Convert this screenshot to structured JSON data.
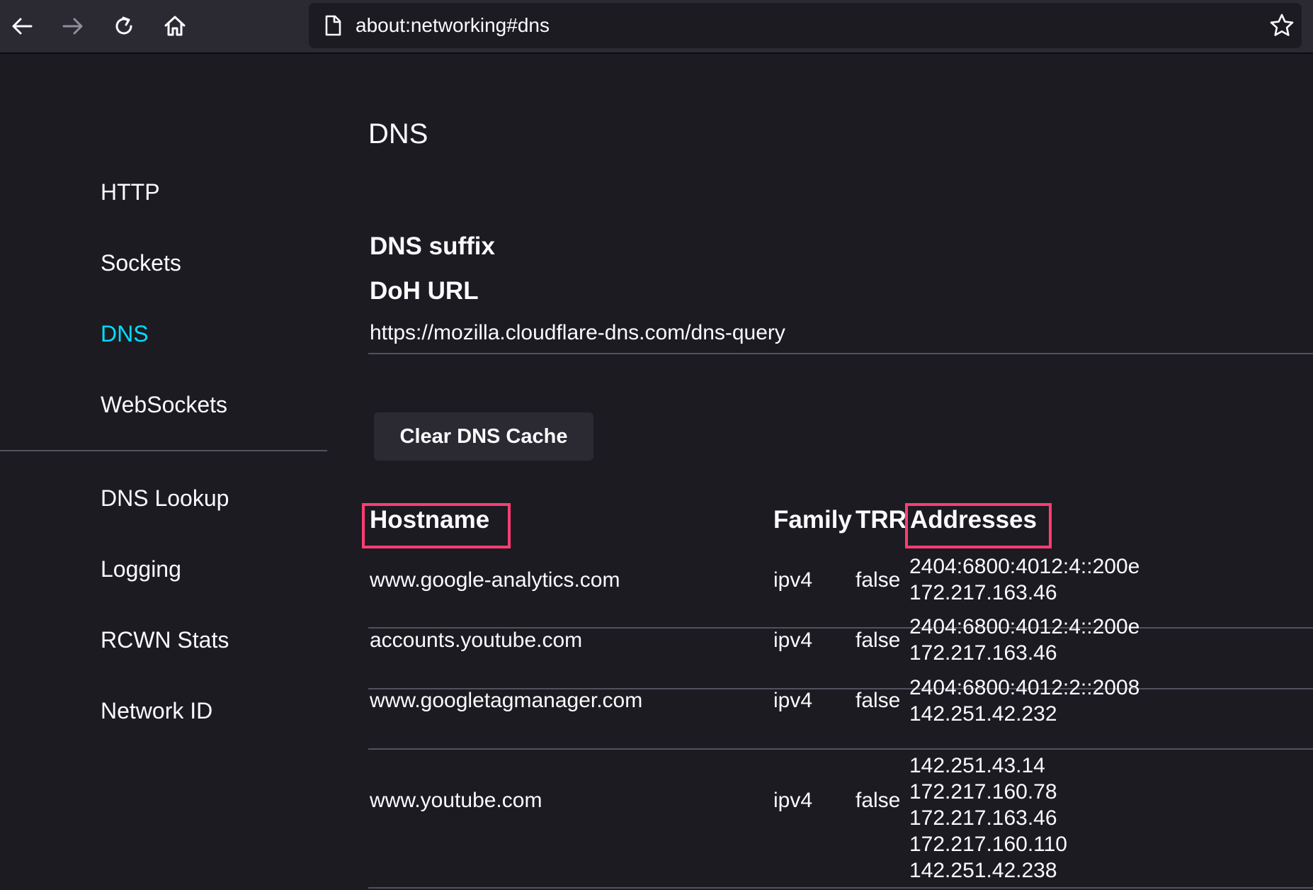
{
  "browser": {
    "url": "about:networking#dns"
  },
  "sidebar": {
    "items": [
      {
        "label": "HTTP"
      },
      {
        "label": "Sockets"
      },
      {
        "label": "DNS"
      },
      {
        "label": "WebSockets"
      },
      {
        "label": "DNS Lookup"
      },
      {
        "label": "Logging"
      },
      {
        "label": "RCWN Stats"
      },
      {
        "label": "Network ID"
      }
    ],
    "selected": "DNS"
  },
  "main": {
    "title": "DNS",
    "dns_suffix_heading": "DNS suffix",
    "doh_url_heading": "DoH URL",
    "doh_url_value": "https://mozilla.cloudflare-dns.com/dns-query",
    "clear_button": "Clear DNS Cache",
    "table": {
      "headers": {
        "hostname": "Hostname",
        "family": "Family",
        "trr": "TRR",
        "addresses": "Addresses"
      },
      "rows": [
        {
          "hostname": "www.google-analytics.com",
          "family": "ipv4",
          "trr": "false",
          "addresses": [
            "2404:6800:4012:4::200e",
            "172.217.163.46"
          ]
        },
        {
          "hostname": "accounts.youtube.com",
          "family": "ipv4",
          "trr": "false",
          "addresses": [
            "2404:6800:4012:4::200e",
            "172.217.163.46"
          ]
        },
        {
          "hostname": "www.googletagmanager.com",
          "family": "ipv4",
          "trr": "false",
          "addresses": [
            "2404:6800:4012:2::2008",
            "142.251.42.232"
          ]
        },
        {
          "hostname": "www.youtube.com",
          "family": "ipv4",
          "trr": "false",
          "addresses": [
            "142.251.43.14",
            "172.217.160.78",
            "172.217.163.46",
            "172.217.160.110",
            "142.251.42.238"
          ]
        }
      ]
    }
  },
  "colors": {
    "background": "#1c1b22",
    "toolbar": "#2b2a33",
    "accent": "#00ddff",
    "highlight": "#ff3d73"
  }
}
